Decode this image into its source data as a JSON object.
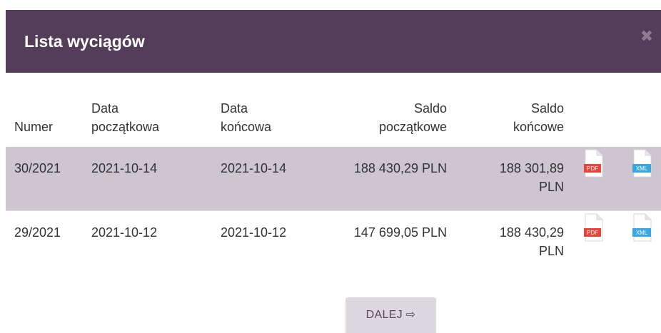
{
  "dialog": {
    "title": "Lista wyciągów",
    "close_icon": "close-icon"
  },
  "table": {
    "columns": {
      "number": [
        "Numer"
      ],
      "start_date": [
        "Data",
        "początkowa"
      ],
      "end_date": [
        "Data",
        "końcowa"
      ],
      "start_balance": [
        "Saldo",
        "początkowe"
      ],
      "end_balance": [
        "Saldo",
        "końcowe"
      ]
    },
    "rows": [
      {
        "number": "30/2021",
        "start_date": "2021-10-14",
        "end_date": "2021-10-14",
        "start_balance": "188 430,29 PLN",
        "end_balance_line1": "188 301,89",
        "end_balance_line2": "PLN",
        "pdf_label": "PDF",
        "xml_label": "XML",
        "highlighted": true
      },
      {
        "number": "29/2021",
        "start_date": "2021-10-12",
        "end_date": "2021-10-12",
        "start_balance": "147 699,05 PLN",
        "end_balance_line1": "188 430,29",
        "end_balance_line2": "PLN",
        "pdf_label": "PDF",
        "xml_label": "XML",
        "highlighted": false
      }
    ]
  },
  "footer": {
    "next_label": "DALEJ ⇨"
  },
  "colors": {
    "header_bg": "#533d59",
    "highlight_row": "#cdc5cf",
    "pdf_badge": "#e8443a",
    "xml_badge": "#3aa7e0"
  }
}
